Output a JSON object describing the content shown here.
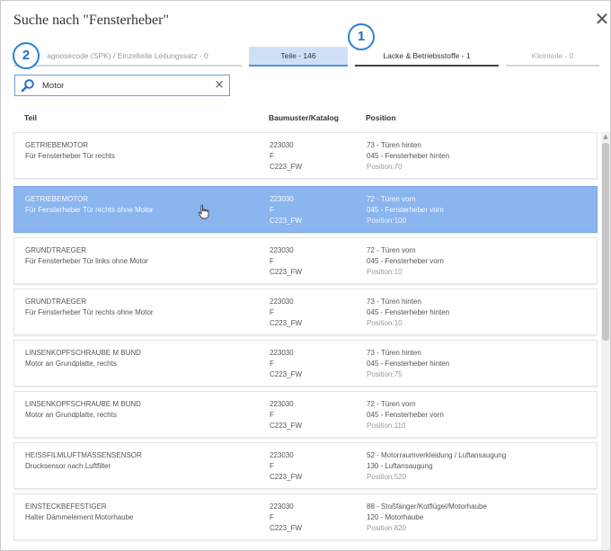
{
  "dialog": {
    "title": "Suche nach \"Fensterheber\"",
    "close_glyph": "✕"
  },
  "tabs": [
    {
      "label": "agnosecode (SPK) / Einzelteile Leitungssatz - 0",
      "state": "inactive"
    },
    {
      "label": "Teile - 146",
      "state": "active"
    },
    {
      "label": "Lacke & Betriebsstoffe - 1",
      "state": "inactive"
    },
    {
      "label": "Kleinteile - 0",
      "state": "disabled"
    }
  ],
  "annotations": [
    "1",
    "2"
  ],
  "search": {
    "value": "Motor",
    "icon": "search-icon",
    "clear_glyph": "×"
  },
  "columns": {
    "teil": "Teil",
    "baumuster": "Baumuster/Katalog",
    "position": "Position"
  },
  "rows": [
    {
      "name": "GETRIEBEMOTOR",
      "desc": "Für Fensterheber Tür rechts",
      "bm": "223030",
      "code": "F",
      "cat": "C223_FW",
      "group": "73 - Türen hinten",
      "sub": "045 - Fensterheber hinten",
      "pos_label": "Position:",
      "pos_value": "70",
      "selected": false
    },
    {
      "name": "GETRIEBEMOTOR",
      "desc": "Für Fensterheber Tür rechts ohne Motor",
      "bm": "223030",
      "code": "F",
      "cat": "C223_FW",
      "group": "72 - Türen vorn",
      "sub": "045 - Fensterheber vorn",
      "pos_label": "Position:",
      "pos_value": "100",
      "selected": true
    },
    {
      "name": "GRUNDTRAEGER",
      "desc": "Für Fensterheber Tür links ohne Motor",
      "bm": "223030",
      "code": "F",
      "cat": "C223_FW",
      "group": "72 - Türen vorn",
      "sub": "045 - Fensterheber vorn",
      "pos_label": "Position:",
      "pos_value": "10",
      "selected": false
    },
    {
      "name": "GRUNDTRAEGER",
      "desc": "Für Fensterheber Tür rechts ohne Motor",
      "bm": "223030",
      "code": "F",
      "cat": "C223_FW",
      "group": "73 - Türen hinten",
      "sub": "045 - Fensterheber hinten",
      "pos_label": "Position:",
      "pos_value": "10",
      "selected": false
    },
    {
      "name": "LINSENKOPFSCHRAUBE M BUND",
      "desc": "Motor an Grundplatte, rechts",
      "bm": "223030",
      "code": "F",
      "cat": "C223_FW",
      "group": "73 - Türen hinten",
      "sub": "045 - Fensterheber hinten",
      "pos_label": "Position:",
      "pos_value": "75",
      "selected": false
    },
    {
      "name": "LINSENKOPFSCHRAUBE M BUND",
      "desc": "Motor an Grundplatte, rechts",
      "bm": "223030",
      "code": "F",
      "cat": "C223_FW",
      "group": "72 - Türen vorn",
      "sub": "045 - Fensterheber vorn",
      "pos_label": "Position:",
      "pos_value": "110",
      "selected": false
    },
    {
      "name": "HEISSFILMLUFTMASSENSENSOR",
      "desc": "Drucksensor nach Luftfilter",
      "bm": "223030",
      "code": "F",
      "cat": "C223_FW",
      "group": "52 - Motorraumverkleidung / Luftansaugung",
      "sub": "130 - Luftansaugung",
      "pos_label": "Position:",
      "pos_value": "520",
      "selected": false
    },
    {
      "name": "EINSTECKBEFESTIGER",
      "desc": "Halter Dämmelement Motorhaube",
      "bm": "223030",
      "code": "F",
      "cat": "C223_FW",
      "group": "88 - Stoßfänger/Kotflügel/Motorhaube",
      "sub": "120 - Motorhaube",
      "pos_label": "Position:",
      "pos_value": "820",
      "selected": false
    }
  ],
  "colors": {
    "accent": "#5b8fd6",
    "selected_row": "#8ab5ef",
    "active_tab": "#cfe0f6",
    "annotation": "#2a7fd4"
  }
}
